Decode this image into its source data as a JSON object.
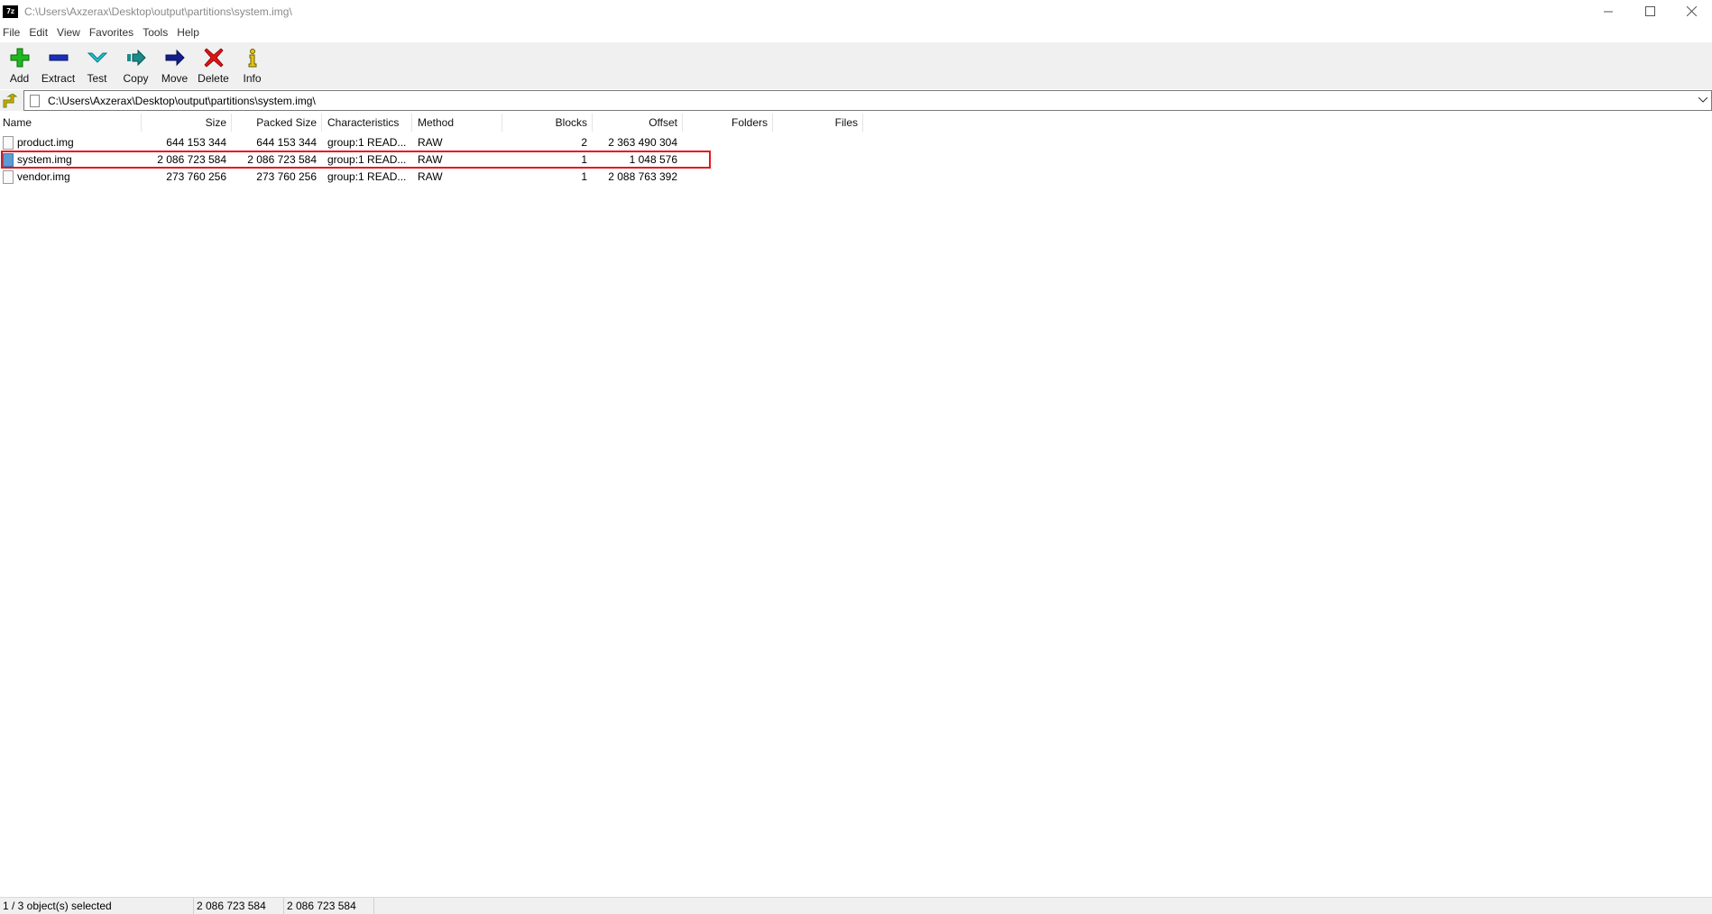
{
  "window": {
    "title": "C:\\Users\\Axzerax\\Desktop\\output\\partitions\\system.img\\",
    "app_icon_text": "7z"
  },
  "menu": [
    "File",
    "Edit",
    "View",
    "Favorites",
    "Tools",
    "Help"
  ],
  "toolbar": [
    {
      "label": "Add",
      "icon": "add-icon"
    },
    {
      "label": "Extract",
      "icon": "extract-icon"
    },
    {
      "label": "Test",
      "icon": "test-icon"
    },
    {
      "label": "Copy",
      "icon": "copy-icon"
    },
    {
      "label": "Move",
      "icon": "move-icon"
    },
    {
      "label": "Delete",
      "icon": "delete-icon"
    },
    {
      "label": "Info",
      "icon": "info-icon"
    }
  ],
  "address": {
    "path": "C:\\Users\\Axzerax\\Desktop\\output\\partitions\\system.img\\"
  },
  "columns": [
    "Name",
    "Size",
    "Packed Size",
    "Characteristics",
    "Method",
    "Blocks",
    "Offset",
    "Folders",
    "Files"
  ],
  "files": [
    {
      "name": "product.img",
      "size": "644 153 344",
      "packed": "644 153 344",
      "characteristics": "group:1 READ...",
      "method": "RAW",
      "blocks": "2",
      "offset": "2 363 490 304",
      "selected": false
    },
    {
      "name": "system.img",
      "size": "2 086 723 584",
      "packed": "2 086 723 584",
      "characteristics": "group:1 READ...",
      "method": "RAW",
      "blocks": "1",
      "offset": "1 048 576",
      "selected": true
    },
    {
      "name": "vendor.img",
      "size": "273 760 256",
      "packed": "273 760 256",
      "characteristics": "group:1 READ...",
      "method": "RAW",
      "blocks": "1",
      "offset": "2 088 763 392",
      "selected": false
    }
  ],
  "status": {
    "selection": "1 / 3 object(s) selected",
    "size": "2 086 723 584",
    "packed": "2 086 723 584"
  },
  "colors": {
    "highlight_box": "#e8141c",
    "toolbar_bg": "#f0f0f0"
  }
}
